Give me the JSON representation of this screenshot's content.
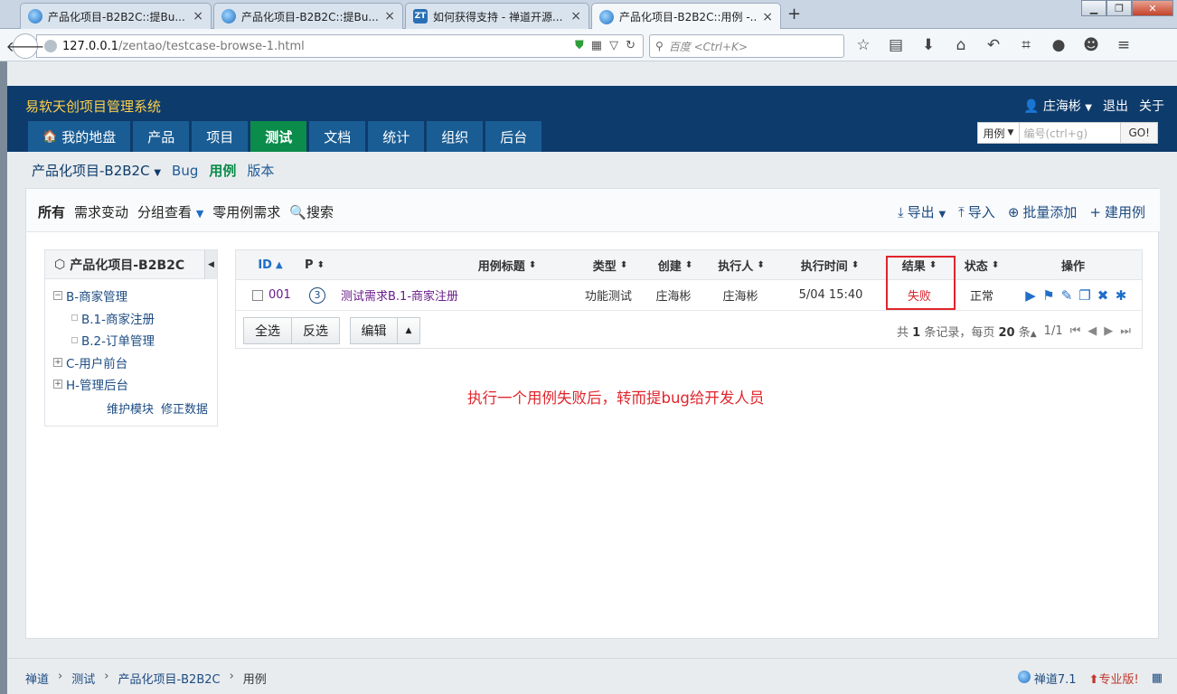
{
  "browser": {
    "tabs": [
      {
        "title": "产品化项目-B2B2C::提Bu...",
        "active": false
      },
      {
        "title": "产品化项目-B2B2C::提Bu...",
        "active": false
      },
      {
        "title": "如何获得支持 - 禅道开源...",
        "active": false
      },
      {
        "title": "产品化项目-B2B2C::用例 -...",
        "active": true
      }
    ],
    "tab_close": "×",
    "new_tab": "+",
    "url_host": "127.0.0.1",
    "url_path": "/zentao/testcase-browse-1.html",
    "search_placeholder": "百度 <Ctrl+K>"
  },
  "app": {
    "title": "易软天创项目管理系统",
    "user": "庄海彬",
    "logout": "退出",
    "about": "关于",
    "nav": [
      {
        "label": "我的地盘",
        "active": false
      },
      {
        "label": "产品",
        "active": false
      },
      {
        "label": "项目",
        "active": false
      },
      {
        "label": "测试",
        "active": true
      },
      {
        "label": "文档",
        "active": false
      },
      {
        "label": "统计",
        "active": false
      },
      {
        "label": "组织",
        "active": false
      },
      {
        "label": "后台",
        "active": false
      }
    ],
    "quick_search": {
      "type": "用例",
      "placeholder": "编号(ctrl+g)",
      "go": "GO!"
    }
  },
  "subnav": {
    "product": "产品化项目-B2B2C",
    "items": [
      "Bug",
      "用例",
      "版本"
    ],
    "active": "用例"
  },
  "featurebar": {
    "left": [
      "所有",
      "需求变动",
      "分组查看",
      "零用例需求",
      "搜索"
    ],
    "right": [
      "导出",
      "导入",
      "批量添加",
      "建用例"
    ]
  },
  "tree": {
    "title": "产品化项目-B2B2C",
    "nodes": [
      {
        "label": "B-商家管理",
        "level": 0,
        "toggle": "⊟"
      },
      {
        "label": "B.1-商家注册",
        "level": 1
      },
      {
        "label": "B.2-订单管理",
        "level": 1
      },
      {
        "label": "C-用户前台",
        "level": 0,
        "toggle": "⊞"
      },
      {
        "label": "H-管理后台",
        "level": 0,
        "toggle": "⊞"
      }
    ],
    "actions": [
      "维护模块",
      "修正数据"
    ]
  },
  "table": {
    "headers": {
      "id": "ID",
      "pri": "P",
      "title": "用例标题",
      "type": "类型",
      "creator": "创建",
      "executor": "执行人",
      "time": "执行时间",
      "result": "结果",
      "status": "状态",
      "actions": "操作"
    },
    "rows": [
      {
        "id": "001",
        "pri": "3",
        "title": "测试需求B.1-商家注册",
        "type": "功能测试",
        "creator": "庄海彬",
        "executor": "庄海彬",
        "time": "5/04 15:40",
        "result": "失败",
        "status": "正常"
      }
    ],
    "footer": {
      "select_all": "全选",
      "invert": "反选",
      "edit": "编辑",
      "pager_total_prefix": "共",
      "pager_total": "1",
      "pager_total_suffix": "条记录，每页",
      "pager_per_page": "20",
      "pager_per_suffix": "条",
      "pager_pages": "1/1"
    }
  },
  "annotation": "执行一个用例失败后，转而提bug给开发人员",
  "footer": {
    "crumbs": [
      "禅道",
      "测试",
      "产品化项目-B2B2C",
      "用例"
    ],
    "version": "禅道7.1",
    "pro": "专业版!"
  },
  "colors": {
    "header_bg": "#0d3b6b",
    "nav_active": "#0b8c4a",
    "fail_red": "#d9232b",
    "link_blue": "#1d4c82"
  }
}
